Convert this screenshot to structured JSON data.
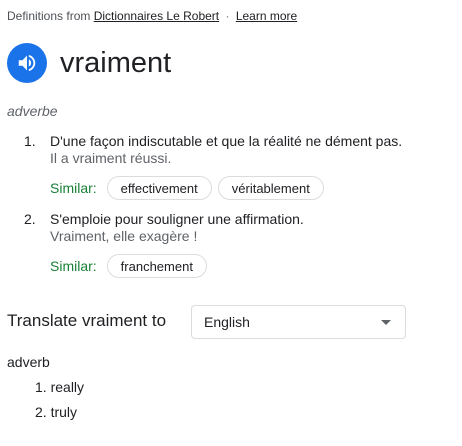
{
  "source": {
    "prefix": "Definitions from",
    "dictionary_link": "Dictionnaires Le Robert",
    "separator": "·",
    "learn_more": "Learn more"
  },
  "entry": {
    "headword": "vraiment",
    "speaker_icon": "speaker-icon",
    "part_of_speech": "adverbe",
    "senses": [
      {
        "number": "1.",
        "definition": "D'une façon indiscutable et que la réalité ne dément pas.",
        "example": "Il a vraiment réussi.",
        "similar_label": "Similar:",
        "similar": [
          "effectivement",
          "véritablement"
        ]
      },
      {
        "number": "2.",
        "definition": "S'emploie pour souligner une affirmation.",
        "example": "Vraiment, elle exagère !",
        "similar_label": "Similar:",
        "similar": [
          "franchement"
        ]
      }
    ]
  },
  "translate": {
    "label": "Translate vraiment to",
    "selected_language": "English",
    "part_of_speech": "adverb",
    "translations": [
      {
        "number": "1.",
        "text": "really"
      },
      {
        "number": "2.",
        "text": "truly"
      }
    ]
  },
  "colors": {
    "accent": "#1a73e8",
    "similar_label": "#188038"
  }
}
